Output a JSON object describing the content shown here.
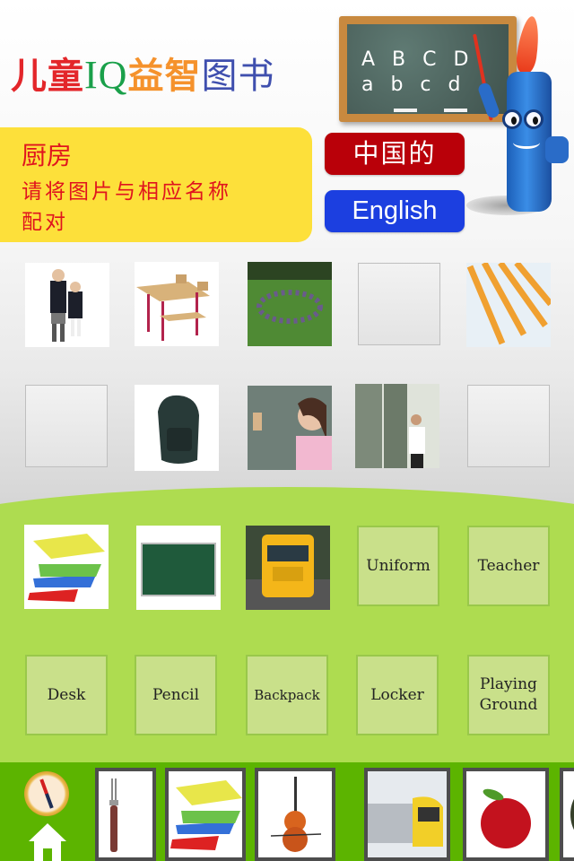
{
  "header": {
    "title_parts": [
      {
        "text": "儿",
        "color": "#e3262a"
      },
      {
        "text": "童",
        "color": "#e3262a"
      },
      {
        "text": "IQ",
        "color": "#1aa04a"
      },
      {
        "text": "益",
        "color": "#f5922c"
      },
      {
        "text": "智",
        "color": "#f5922c"
      },
      {
        "text": "图",
        "color": "#3f4fae"
      },
      {
        "text": "书",
        "color": "#3f4fae"
      }
    ],
    "chalkboard_line1": "A B C D",
    "chalkboard_line2": "a b c d"
  },
  "instruction": {
    "category": "厨房",
    "line1": "请将图片与相应名称",
    "line2": "配对"
  },
  "language": {
    "chinese_label": "中国的",
    "english_label": "English",
    "chinese_color": "#b90009",
    "english_color": "#1c3fe0"
  },
  "picture_slots": [
    {
      "icon": "uniform-students-image",
      "filled": true
    },
    {
      "icon": "school-desk-image",
      "filled": true
    },
    {
      "icon": "playground-children-image",
      "filled": true
    },
    {
      "icon": "empty-slot",
      "filled": false
    },
    {
      "icon": "pencils-image",
      "filled": true
    },
    {
      "icon": "empty-slot",
      "filled": false
    },
    {
      "icon": "backpack-image",
      "filled": true
    },
    {
      "icon": "teacher-chalkboard-image",
      "filled": true
    },
    {
      "icon": "locker-image",
      "filled": true
    },
    {
      "icon": "empty-slot",
      "filled": false
    }
  ],
  "answer_images": [
    {
      "icon": "books-stack-image"
    },
    {
      "icon": "green-board-image"
    },
    {
      "icon": "school-bus-image"
    }
  ],
  "word_cards": {
    "uniform": "Uniform",
    "teacher": "Teacher",
    "desk": "Desk",
    "pencil": "Pencil",
    "backpack": "Backpack",
    "locker": "Locker",
    "playing_ground_line1": "Playing",
    "playing_ground_line2": "Ground"
  },
  "bottom_bar": {
    "nav_icons": [
      "compass-icon",
      "home-icon"
    ],
    "category_thumbnails": [
      "fork-image",
      "books-image",
      "violin-image",
      "train-image",
      "apple-image",
      "avocado-image"
    ]
  }
}
